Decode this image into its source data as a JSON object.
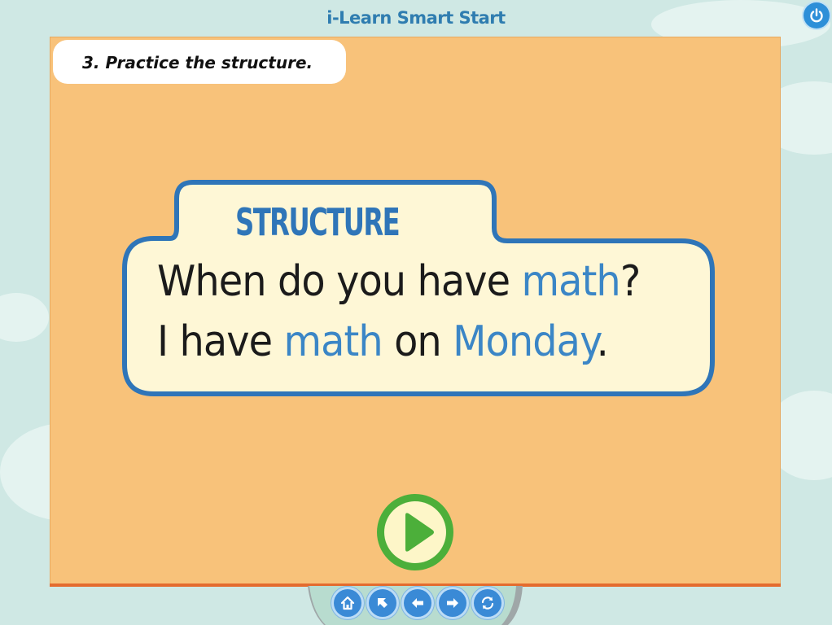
{
  "app": {
    "title": "i-Learn Smart Start"
  },
  "instruction": {
    "text": "3. Practice the structure."
  },
  "structure": {
    "heading": "STRUCTURE",
    "question": {
      "part1": "When do you have ",
      "highlight": "math",
      "part2": "?"
    },
    "answer": {
      "part1": "I have ",
      "highlight1": "math",
      "part2": " on ",
      "highlight2": "Monday",
      "part3": "."
    }
  },
  "controls": {
    "play": "play-icon",
    "power": "power-icon",
    "nav": [
      "home-icon",
      "cursor-arrow-icon",
      "previous-icon",
      "next-icon",
      "refresh-icon"
    ]
  },
  "colors": {
    "stage": "#f8c27a",
    "accent": "#2f75b8",
    "highlight": "#3b86c6",
    "play": "#4caf3a",
    "background": "#cfe8e4"
  }
}
